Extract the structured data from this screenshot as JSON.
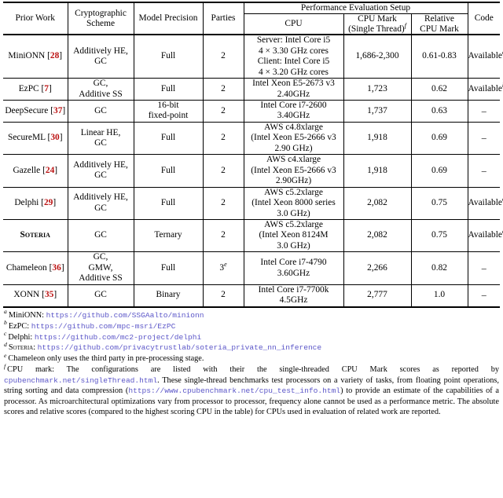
{
  "table": {
    "columns": {
      "prior_work": "Prior Work",
      "crypto_scheme": "Cryptographic Scheme",
      "model_precision": "Model Precision",
      "parties": "Parties",
      "perf_group": "Performance Evaluation Setup",
      "cpu": "CPU",
      "cpu_mark": "CPU Mark",
      "cpu_mark_sub": "(Single Thread)",
      "cpu_mark_note": "f",
      "relative_cpu_mark": "Relative CPU Mark",
      "code": "Code"
    },
    "rows": [
      {
        "work": "MiniONN",
        "cite": "28",
        "scheme": "Additively HE, GC",
        "precision": "Full",
        "parties": "2",
        "parties_note": "",
        "cpu": "Server: Intel Core i5\n4 × 3.30 GHz cores\nClient: Intel Core i5\n4 × 3.20 GHz cores",
        "cpu_mark": "1,686-2,300",
        "relative": "0.61-0.83",
        "code": "Available",
        "code_note": "a"
      },
      {
        "work": "EzPC",
        "cite": "7",
        "scheme": "GC,\nAdditive SS",
        "precision": "Full",
        "parties": "2",
        "parties_note": "",
        "cpu": "Intel Xeon E5-2673 v3\n2.40GHz",
        "cpu_mark": "1,723",
        "relative": "0.62",
        "code": "Available",
        "code_note": "b"
      },
      {
        "work": "DeepSecure",
        "cite": "37",
        "scheme": "GC",
        "precision": "16-bit\nfixed-point",
        "parties": "2",
        "parties_note": "",
        "cpu": "Intel Core i7-2600\n3.40GHz",
        "cpu_mark": "1,737",
        "relative": "0.63",
        "code": "–",
        "code_note": ""
      },
      {
        "work": "SecureML",
        "cite": "30",
        "scheme": "Linear HE,\nGC",
        "precision": "Full",
        "parties": "2",
        "parties_note": "",
        "cpu": "AWS c4.8xlarge\n(Intel Xeon E5-2666 v3\n2.90 GHz)",
        "cpu_mark": "1,918",
        "relative": "0.69",
        "code": "–",
        "code_note": ""
      },
      {
        "work": "Gazelle",
        "cite": "24",
        "scheme": "Additively HE,\nGC",
        "precision": "Full",
        "parties": "2",
        "parties_note": "",
        "cpu": "AWS c4.xlarge\n(Intel Xeon E5-2666 v3\n2.90GHz)",
        "cpu_mark": "1,918",
        "relative": "0.69",
        "code": "–",
        "code_note": ""
      },
      {
        "work": "Delphi",
        "cite": "29",
        "scheme": "Additively HE,\nGC",
        "precision": "Full",
        "parties": "2",
        "parties_note": "",
        "cpu": "AWS c5.2xlarge\n(Intel Xeon 8000 series\n3.0 GHz)",
        "cpu_mark": "2,082",
        "relative": "0.75",
        "code": "Available",
        "code_note": "c"
      },
      {
        "work": "Soteria",
        "cite": "",
        "smallcaps": true,
        "scheme": "GC",
        "precision": "Ternary",
        "parties": "2",
        "parties_note": "",
        "cpu": "AWS c5.2xlarge\n(Intel Xeon 8124M\n3.0 GHz)",
        "cpu_mark": "2,082",
        "relative": "0.75",
        "code": "Available",
        "code_note": "d"
      },
      {
        "work": "Chameleon",
        "cite": "36",
        "scheme": "GC,\nGMW,\nAdditive SS",
        "precision": "Full",
        "parties": "3",
        "parties_note": "e",
        "cpu": "Intel Core i7-4790\n3.60GHz",
        "cpu_mark": "2,266",
        "relative": "0.82",
        "code": "–",
        "code_note": ""
      },
      {
        "work": "XONN",
        "cite": "35",
        "scheme": "GC",
        "precision": "Binary",
        "parties": "2",
        "parties_note": "",
        "cpu": "Intel Core i7-7700k\n4.5GHz",
        "cpu_mark": "2,777",
        "relative": "1.0",
        "code": "–",
        "code_note": ""
      }
    ]
  },
  "footnotes": {
    "a": {
      "mark": "a",
      "label": "MiniONN:",
      "url": "https://github.com/SSGAalto/minionn"
    },
    "b": {
      "mark": "b",
      "label": "EzPC:",
      "url": "https://github.com/mpc-msri/EzPC"
    },
    "c": {
      "mark": "c",
      "label": "Delphi:",
      "url": "https://github.com/mc2-project/delphi"
    },
    "d": {
      "mark": "d",
      "label": "Soteria:",
      "url": "https://github.com/privacytrustlab/soteria_private_nn_inference"
    },
    "e": {
      "mark": "e",
      "text": "Chameleon only uses the third party in pre-processing stage."
    },
    "f": {
      "mark": "f",
      "part1": "CPU mark: The configurations are listed with their the single-threaded CPU Mark scores as reported by ",
      "url1": "cpubenchmark.net/singleThread.html",
      "part2": ". These single-thread benchmarks test processors on a variety of tasks, from floating point operations, string sorting and data compression (",
      "url2": "https://www.cpubenchmark.net/cpu_test_info.html",
      "part3": ") to provide an estimate of the capabilities of a processor. As microarchitectural optimizations vary from processor to processor, frequency alone cannot be used as a performance metric. The absolute scores and relative scores (compared to the highest scoring CPU in the table) for CPUs used in evaluation of related work are reported."
    }
  },
  "colors": {
    "citation": "#bb1111",
    "link": "#5b56c8",
    "rule": "#000000"
  }
}
